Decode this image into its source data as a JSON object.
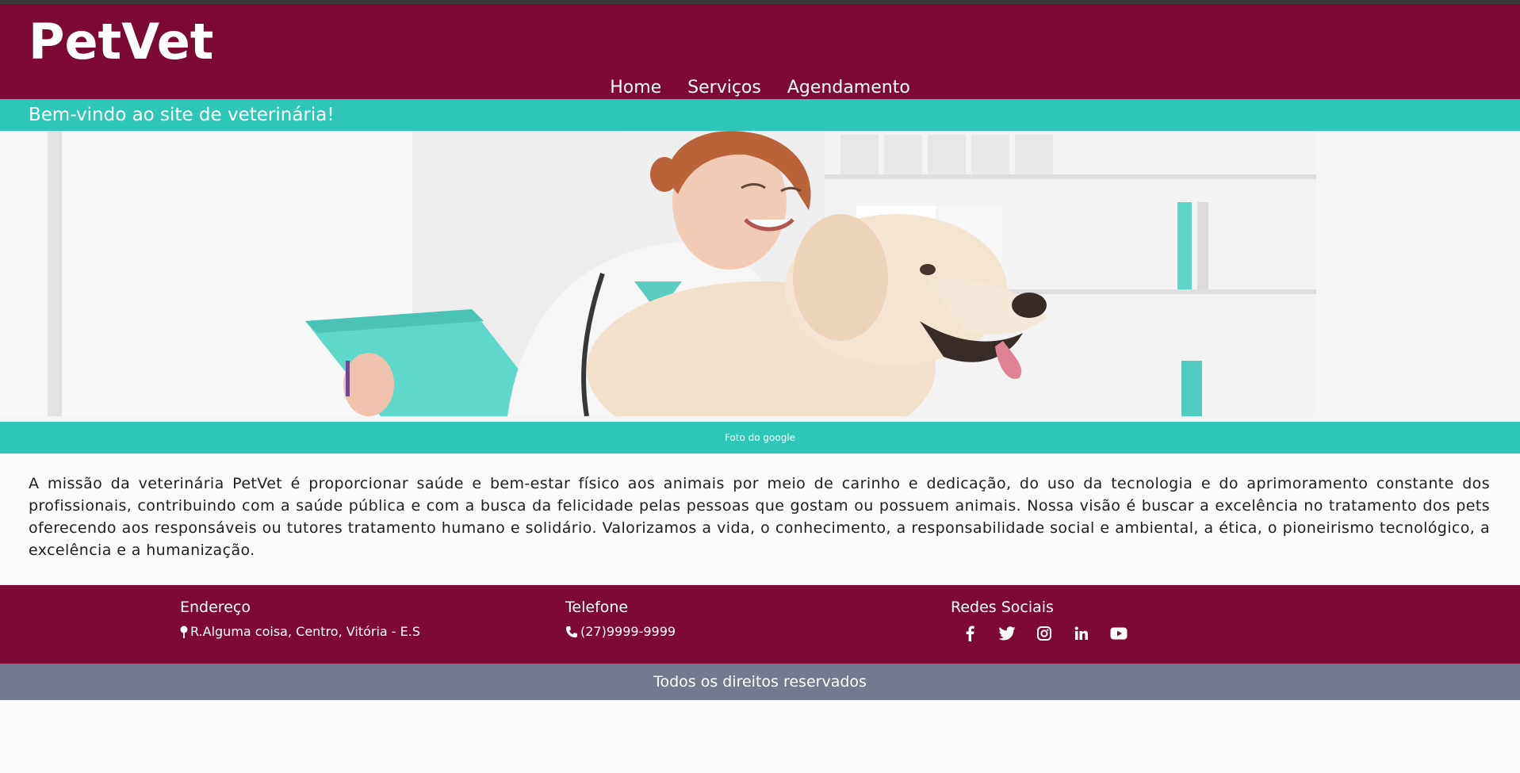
{
  "header": {
    "brand": "PetVet",
    "nav": [
      "Home",
      "Serviços",
      "Agendamento"
    ]
  },
  "welcome": "Bem-vindo ao site de veterinária!",
  "hero": {
    "caption": "Foto do google"
  },
  "mission": "A missão da veterinária PetVet é proporcionar saúde e bem-estar físico aos animais por meio de carinho e dedicação, do uso da tecnologia e do aprimoramento constante dos profissionais, contribuindo com a saúde pública e com a busca da felicidade pelas pessoas que gostam ou possuem animais. Nossa visão é buscar a excelência no tratamento dos pets oferecendo aos responsáveis ou tutores tratamento humano e solidário. Valorizamos a vida, o conhecimento, a responsabilidade social e ambiental, a ética, o pioneirismo tecnológico, a excelência e a humanização.",
  "footer": {
    "address_title": "Endereço",
    "address": "R.Alguma coisa, Centro, Vitória - E.S",
    "phone_title": "Telefone",
    "phone": "(27)9999-9999",
    "social_title": "Redes Sociais",
    "social_icons": [
      "facebook-icon",
      "twitter-icon",
      "instagram-icon",
      "linkedin-icon",
      "youtube-icon"
    ]
  },
  "rights": "Todos os direitos reservados",
  "colors": {
    "primary": "#7d0935",
    "accent": "#2ec6b8",
    "footer_bar": "#737a8e",
    "background": "#fbfafa"
  }
}
